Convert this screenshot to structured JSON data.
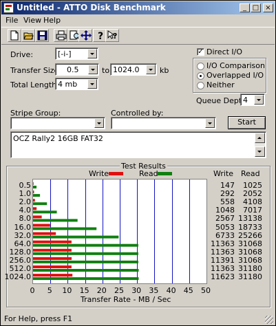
{
  "window": {
    "title": "Untitled - ATTO Disk Benchmark"
  },
  "titlebar_buttons": {
    "minimize": "_",
    "maximize": "□",
    "close": "×"
  },
  "menu": [
    "File",
    "View",
    "Help"
  ],
  "toolbar": [
    "new-icon",
    "open-icon",
    "save-icon",
    "print-icon",
    "print-preview-icon",
    "move-icon",
    "help-icon",
    "context-help-icon"
  ],
  "form": {
    "drive_label": "Drive:",
    "drive_value": "[-i-]",
    "transfer_size_label": "Transfer Size:",
    "transfer_from": "0.5",
    "to_label": "to",
    "transfer_to": "1024.0",
    "kb_label": "kb",
    "total_length_label": "Total Length:",
    "total_length_value": "4 mb",
    "direct_io_label": "Direct I/O",
    "direct_io_checked": true,
    "radio_io_comparison": "I/O Comparison",
    "radio_overlapped_io": "Overlapped I/O",
    "radio_neither": "Neither",
    "selected_radio": "Overlapped I/O",
    "queue_depth_label": "Queue Depth:",
    "queue_depth_value": "4",
    "stripe_group_label": "Stripe Group:",
    "stripe_group_value": "",
    "controlled_by_label": "Controlled by:",
    "controlled_by_value": "",
    "start_button": "Start",
    "description": "OCZ Rally2 16GB FAT32"
  },
  "results": {
    "group_title": "Test Results",
    "legend_write": "Write",
    "legend_read": "Read",
    "col_write": "Write",
    "col_read": "Read",
    "xlabel": "Transfer Rate - MB / Sec"
  },
  "chart_data": {
    "type": "bar",
    "orientation": "horizontal",
    "title": "Test Results",
    "xlabel": "Transfer Rate - MB / Sec",
    "ylabel": "",
    "xlim": [
      0,
      50
    ],
    "xticks": [
      "0",
      "5",
      "10",
      "15",
      "20",
      "25",
      "30",
      "35",
      "40",
      "45",
      "50"
    ],
    "categories": [
      "0.5",
      "1.0",
      "2.0",
      "4.0",
      "8.0",
      "16.0",
      "32.0",
      "64.0",
      "128.0",
      "256.0",
      "512.0",
      "1024.0"
    ],
    "series": [
      {
        "name": "Write",
        "color": "#e01010",
        "values_kb_s": [
          147,
          292,
          558,
          1048,
          2567,
          5053,
          6733,
          11363,
          11363,
          11391,
          11363,
          11623
        ]
      },
      {
        "name": "Read",
        "color": "#108010",
        "values_kb_s": [
          1025,
          2052,
          4108,
          7017,
          13138,
          18733,
          25266,
          31068,
          31068,
          31068,
          31180,
          31180
        ]
      }
    ],
    "grid": true,
    "legend": "top"
  },
  "statusbar": {
    "text": "For Help, press F1"
  }
}
